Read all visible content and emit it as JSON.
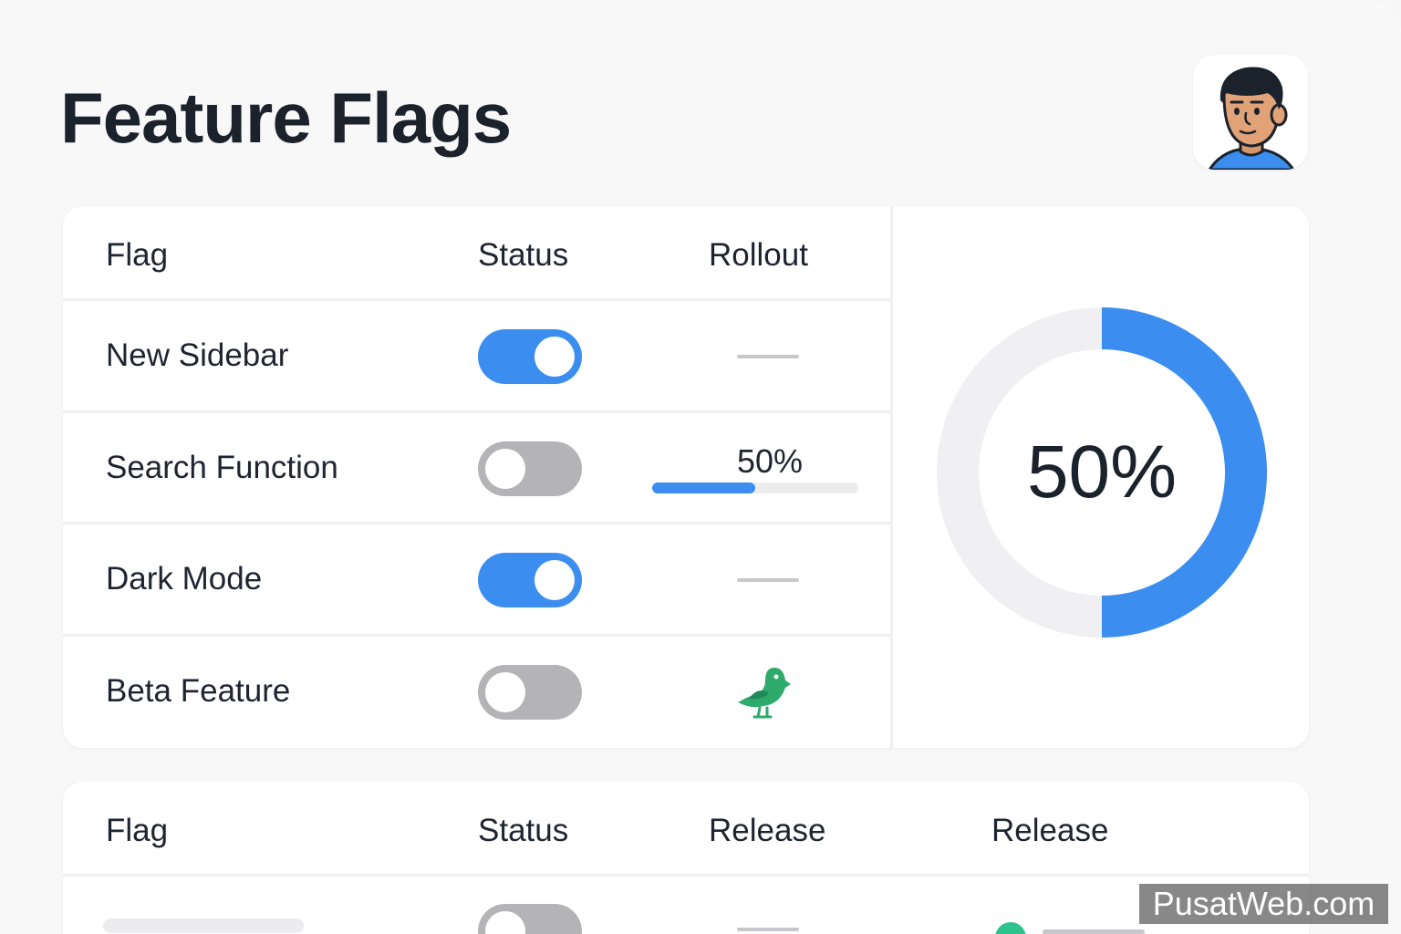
{
  "page": {
    "title": "Feature Flags"
  },
  "colors": {
    "accent": "#3b8ef0",
    "toggle_off": "#b4b4b6",
    "bird": "#2eaa6b"
  },
  "flags_table": {
    "headers": {
      "flag": "Flag",
      "status": "Status",
      "rollout": "Rollout"
    },
    "rows": [
      {
        "name": "New Sidebar",
        "enabled": true,
        "rollout": null
      },
      {
        "name": "Search Function",
        "enabled": false,
        "rollout": "50%",
        "rollout_value": 50
      },
      {
        "name": "Dark Mode",
        "enabled": true,
        "rollout": null
      },
      {
        "name": "Beta Feature",
        "enabled": false,
        "rollout_icon": "bird-icon"
      }
    ]
  },
  "rollout_chart": {
    "label": "50%",
    "value": 50
  },
  "release_table": {
    "headers": {
      "flag": "Flag",
      "status": "Status",
      "release1": "Release",
      "release2": "Release"
    },
    "rows": [
      {
        "enabled": false
      }
    ]
  },
  "watermark": "PusatWeb.com"
}
